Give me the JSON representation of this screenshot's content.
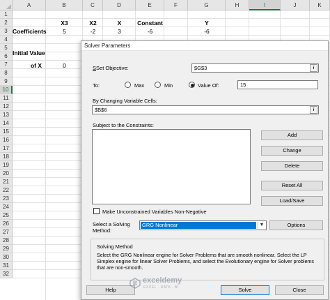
{
  "sheet": {
    "columns": [
      "A",
      "B",
      "C",
      "D",
      "E",
      "F",
      "G",
      "H",
      "I",
      "J",
      "K"
    ],
    "rows": [
      "1",
      "2",
      "3",
      "4",
      "5",
      "6",
      "7",
      "8",
      "9",
      "10",
      "11",
      "12",
      "13",
      "14",
      "15",
      "16",
      "17",
      "18",
      "19",
      "20",
      "21",
      "22",
      "23",
      "24",
      "25",
      "26",
      "27",
      "28",
      "29",
      "30",
      "31",
      "32"
    ],
    "selected_column": "I",
    "selected_row": "10",
    "headers_row2": {
      "b": "X3",
      "c": "X2",
      "d": "X",
      "e": "Constant",
      "g": "Y"
    },
    "row3": {
      "a": "Coefficients",
      "b": "5",
      "c": "-2",
      "d": "3",
      "e": "-6",
      "g": "-6"
    },
    "initial_value": {
      "line1": "Initial Value",
      "line2": "of X",
      "b": "0"
    }
  },
  "dialog": {
    "title": "Solver Parameters",
    "set_objective_label": "Set Objective:",
    "set_objective_value": "$G$3",
    "to_label": "To:",
    "radio_max": "Max",
    "radio_min": "Min",
    "radio_value_of": "Value Of:",
    "value_of": "15",
    "selected_radio": "value_of",
    "changing_cells_label": "By Changing Variable Cells:",
    "changing_cells_value": "$B$6",
    "constraints_label": "Subject to the Constraints:",
    "buttons": {
      "add": "Add",
      "change": "Change",
      "delete": "Delete",
      "reset_all": "Reset All",
      "load_save": "Load/Save",
      "options": "Options",
      "help": "Help",
      "solve": "Solve",
      "close": "Close"
    },
    "unconstrained_label": "Make Unconstrained Variables Non-Negative",
    "unconstrained_checked": false,
    "method_label_line1": "Select a Solving",
    "method_label_line2": "Method:",
    "method_value": "GRG Nonlinear",
    "solving_method_title": "Solving Method",
    "solving_method_text": "Select the GRG Nonlinear engine for Solver Problems that are smooth nonlinear. Select the LP Simplex engine for linear Solver Problems, and select the Evolutionary engine for Solver problems that are non-smooth."
  },
  "watermark": {
    "name": "exceldemy",
    "tagline": "EXCEL · DATA · BI"
  },
  "colors": {
    "excel_green": "#217346",
    "accent_blue": "#0078d7"
  }
}
